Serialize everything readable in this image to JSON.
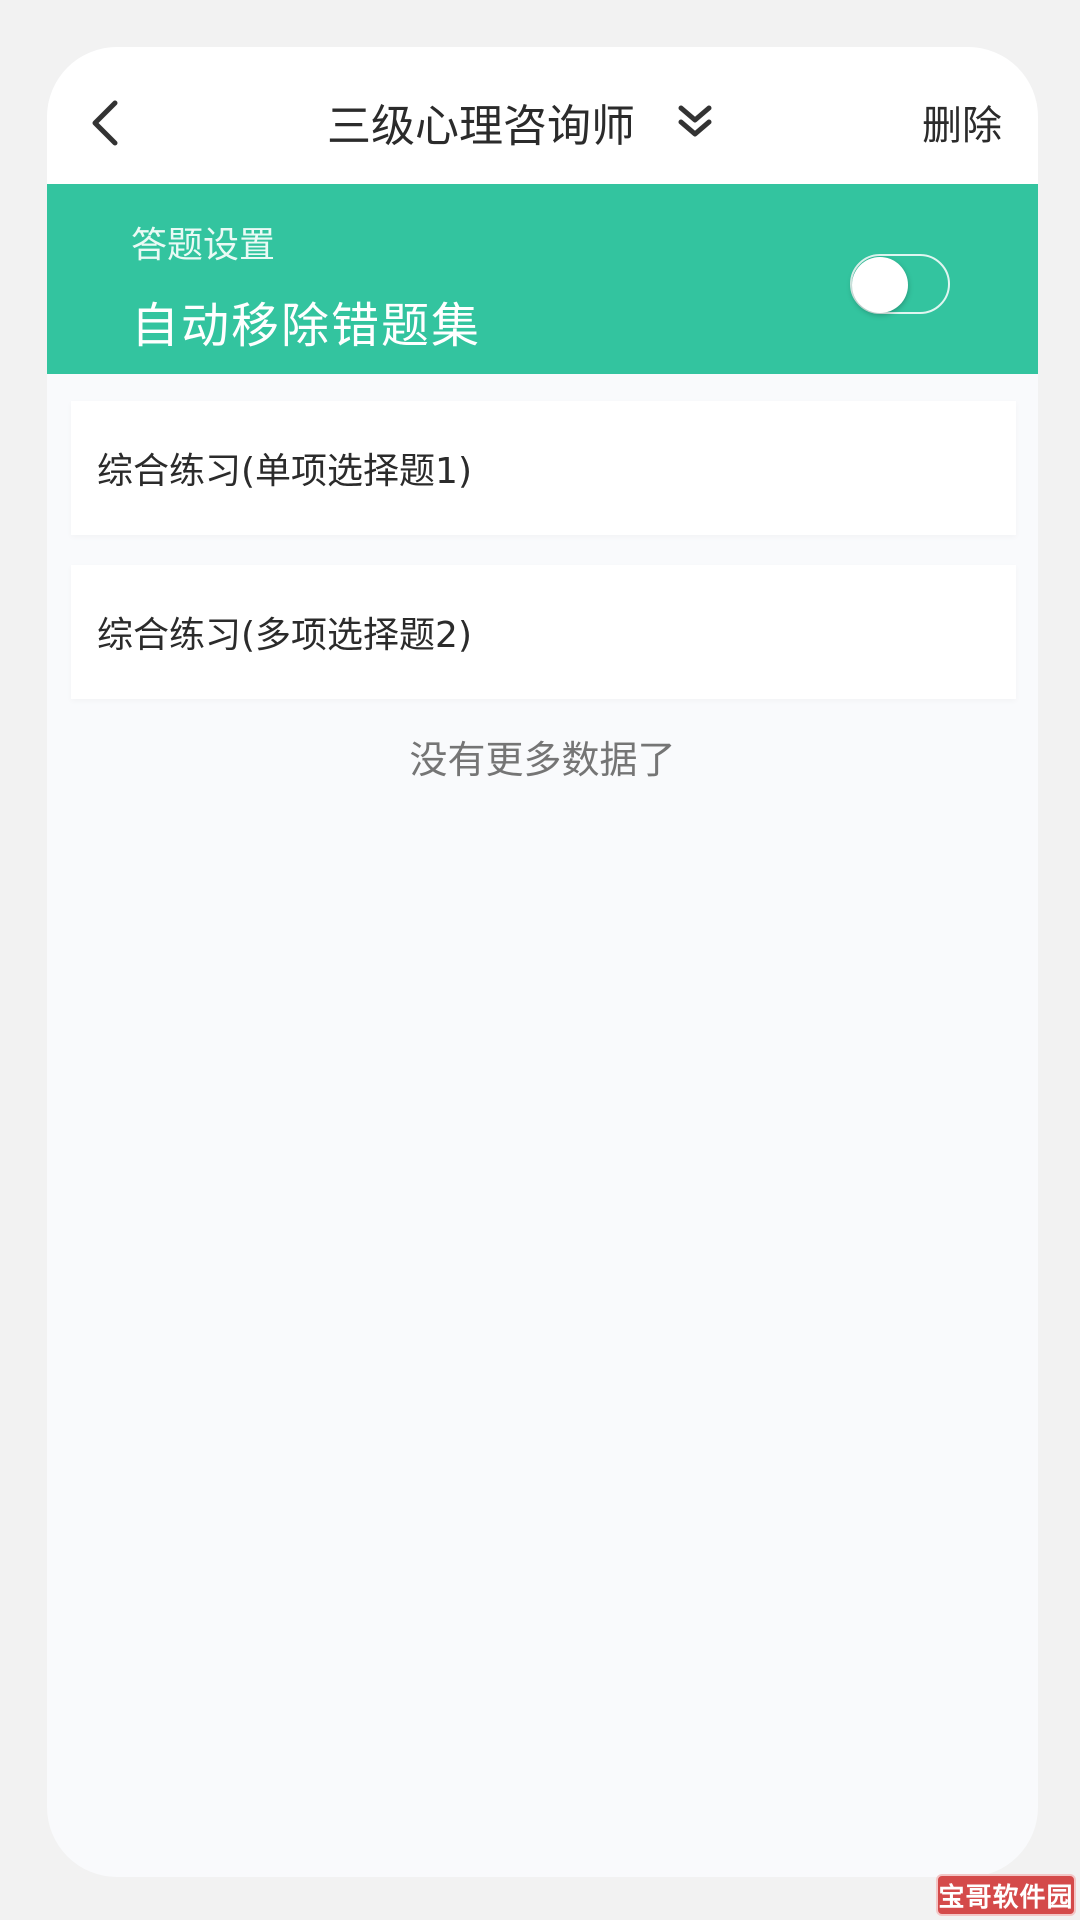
{
  "header": {
    "back_icon": "chevron-left-icon",
    "title": "三级心理咨询师",
    "dropdown_icon": "double-chevron-down-icon",
    "delete_label": "删除"
  },
  "settings": {
    "label": "答题设置",
    "title": "自动移除错题集",
    "toggle_on": false,
    "accent_color": "#33c49f"
  },
  "list": {
    "items": [
      {
        "label": "综合练习(单项选择题1)"
      },
      {
        "label": "综合练习(多项选择题2)"
      }
    ],
    "empty_text": "没有更多数据了"
  },
  "watermark": {
    "text": "宝哥软件园"
  }
}
